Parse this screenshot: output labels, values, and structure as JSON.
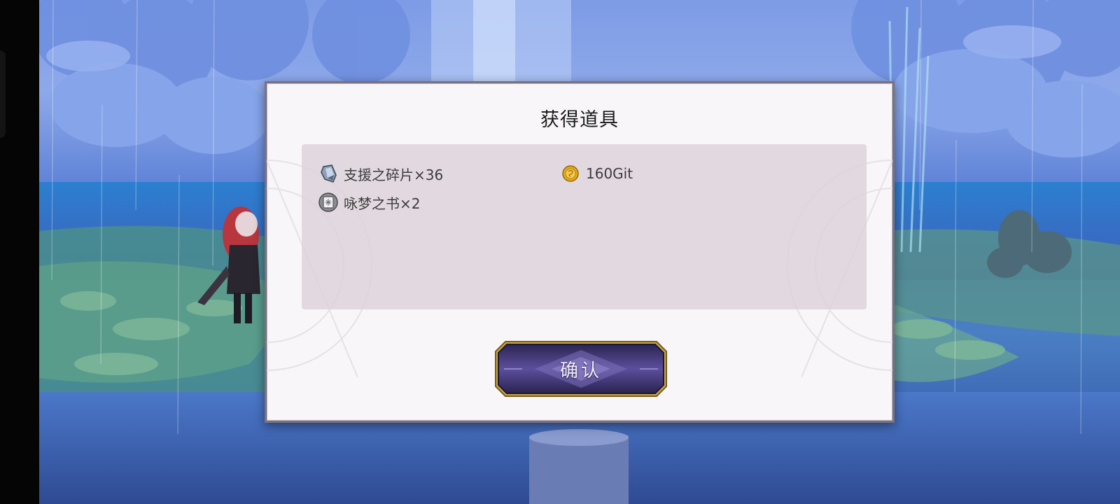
{
  "dialog": {
    "title": "获得道具",
    "confirm_label": "确认"
  },
  "rewards": [
    {
      "name": "支援之碎片×36",
      "icon": "crystal-shard-icon"
    },
    {
      "name": "160Git",
      "icon": "gold-coin-icon"
    },
    {
      "name": "咏梦之书×2",
      "icon": "book-icon"
    }
  ],
  "colors": {
    "dialog_bg": "#f8f6f9",
    "panel_bg": "#dbd1d9",
    "button_purple": "#4b3f86",
    "button_gold": "#c9a646",
    "scene_blue": "#3f6fc5"
  }
}
